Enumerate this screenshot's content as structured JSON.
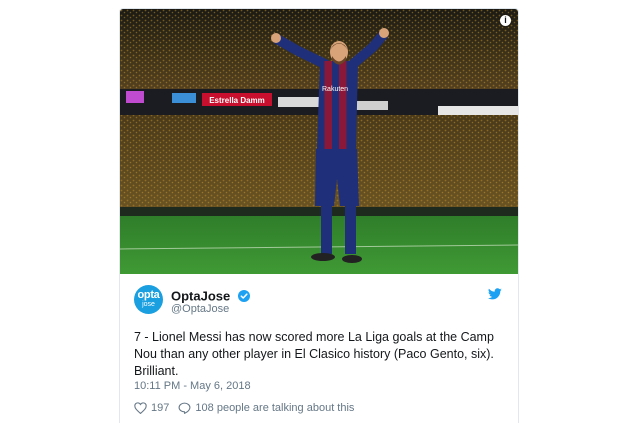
{
  "tweet": {
    "display_name": "OptaJose",
    "handle": "@OptaJose",
    "avatar": {
      "line1": "opta",
      "line2": "jose",
      "color": "#1a9fe0"
    },
    "text": "7 - Lionel Messi has now scored more La Liga goals at the Camp Nou than any other player in El Clasico history (Paco Gento, six). Brilliant.",
    "timestamp": "10:11 PM - May 6, 2018",
    "likes": "197",
    "talking": "108 people are talking about this",
    "media": {
      "description": "Player in blue and red striped kit celebrating with arms raised in a crowded stadium at night",
      "board_text": "Estrella Damm"
    },
    "icons": {
      "info": "info-icon",
      "verified": "verified-badge-icon",
      "bird": "twitter-bird-icon",
      "like": "heart-icon",
      "reply": "speech-bubble-icon"
    },
    "colors": {
      "accent": "#1da1f2",
      "text": "#14171a",
      "muted": "#657786"
    }
  }
}
